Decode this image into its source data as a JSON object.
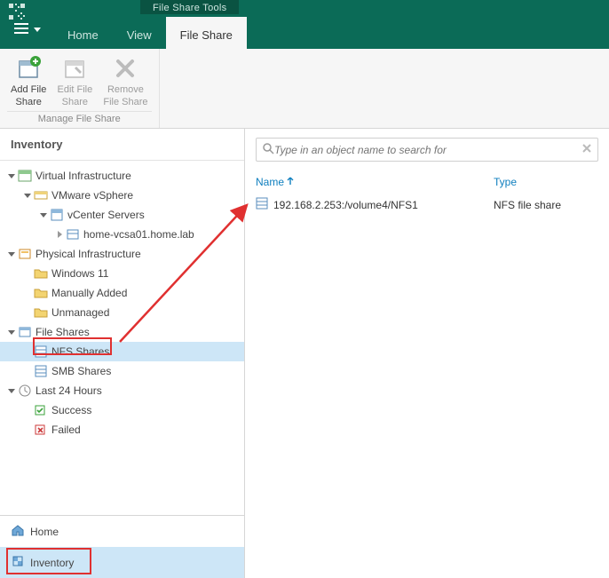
{
  "ribbon": {
    "context_tab_group": "File Share Tools",
    "tabs": {
      "home": "Home",
      "view": "View",
      "fileshare": "File Share"
    },
    "buttons": {
      "add": {
        "line1": "Add File",
        "line2": "Share"
      },
      "edit": {
        "line1": "Edit File",
        "line2": "Share"
      },
      "remove": {
        "line1": "Remove",
        "line2": "File Share"
      }
    },
    "group_label": "Manage File Share"
  },
  "left": {
    "title": "Inventory",
    "tree": {
      "vi": "Virtual Infrastructure",
      "vsphere": "VMware vSphere",
      "vcenter": "vCenter Servers",
      "vcsa": "home-vcsa01.home.lab",
      "pi": "Physical Infrastructure",
      "win11": "Windows 11",
      "manual": "Manually Added",
      "unmanaged": "Unmanaged",
      "shares": "File Shares",
      "nfs": "NFS Shares",
      "smb": "SMB Shares",
      "last24": "Last 24 Hours",
      "success": "Success",
      "failed": "Failed"
    },
    "bottom": {
      "home": "Home",
      "inventory": "Inventory"
    }
  },
  "right": {
    "search_placeholder": "Type in an object name to search for",
    "columns": {
      "name": "Name",
      "type": "Type"
    },
    "rows": [
      {
        "name": "192.168.2.253:/volume4/NFS1",
        "type": "NFS file share"
      }
    ]
  }
}
